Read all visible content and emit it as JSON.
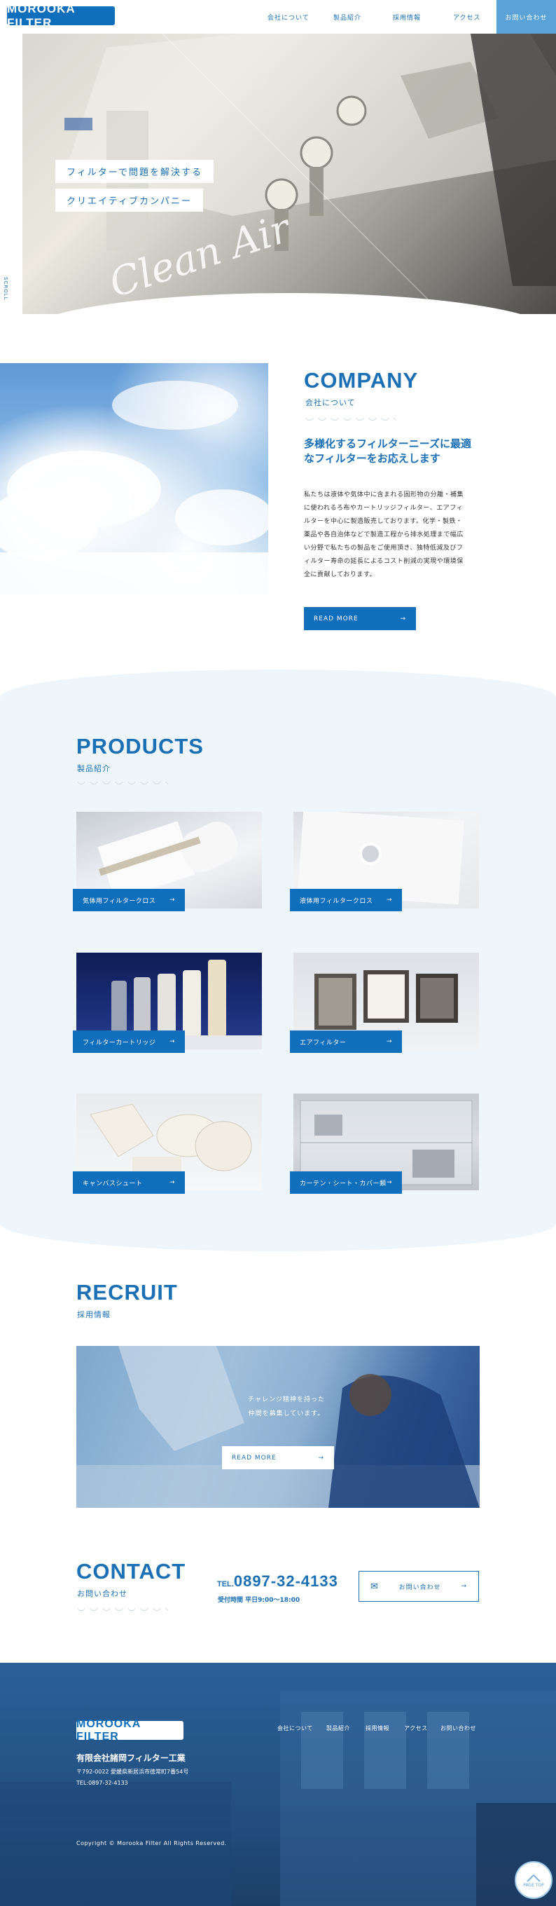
{
  "header": {
    "logo": "MOROOKA FILTER",
    "nav": [
      "会社について",
      "製品紹介",
      "採用情報",
      "アクセス"
    ],
    "contact_button": "お問い合わせ"
  },
  "hero": {
    "line1": "フィルターで問題を解決する",
    "line2": "クリエイティブカンパニー",
    "script_text": "Clean Air",
    "side_tag": "SCROLL"
  },
  "company": {
    "title_en": "COMPANY",
    "title_ja": "会社について",
    "catch": "多様化するフィルターニーズに最適なフィルターをお応えします",
    "body": "私たちは液体や気体中に含まれる固形物の分離・補集に使われるろ布やカートリッジフィルター、エアフィルターを中心に製造販売しております。化学・製鉄・薬品や各自治体などで製造工程から排水処理まで幅広い分野で私たちの製品をご使用頂き、独特低減及びフィルター寿命の延長によるコスト削減の実現や環境保全に貢献しております。",
    "button": "READ MORE"
  },
  "products": {
    "title_en": "PRODUCTS",
    "title_ja": "製品紹介",
    "items": [
      {
        "label": "気体用フィルタークロス"
      },
      {
        "label": "液体用フィルタークロス"
      },
      {
        "label": "フィルターカートリッジ"
      },
      {
        "label": "エアフィルター"
      },
      {
        "label": "キャンバスシュート"
      },
      {
        "label": "カーテン・シート・カバー類"
      }
    ]
  },
  "recruit": {
    "title_en": "RECRUIT",
    "title_ja": "採用情報",
    "line1": "チャレンジ精神を持った",
    "line2": "仲間を募集しています。",
    "button": "READ MORE"
  },
  "contact": {
    "title_en": "CONTACT",
    "title_ja": "お問い合わせ",
    "tel_prefix": "TEL.",
    "tel": "0897-32-4133",
    "hours": "受付時間 平日9:00〜18:00",
    "button": "お問い合わせ"
  },
  "footer": {
    "logo": "MOROOKA FILTER",
    "company": "有限会社諸岡フィルター工業",
    "address": "〒792-0022 愛媛県新居浜市徳常町7番54号",
    "tel": "TEL:0897-32-4133",
    "nav": [
      "会社について",
      "製品紹介",
      "採用情報",
      "アクセス",
      "お問い合わせ"
    ],
    "copyright": "Copyright © Morooka Filter All Rights Reserved.",
    "pagetop": "PAGE TOP"
  },
  "colors": {
    "brand": "#0f6fbd",
    "light_bg": "#eef6fc",
    "footer": "#234f80"
  }
}
